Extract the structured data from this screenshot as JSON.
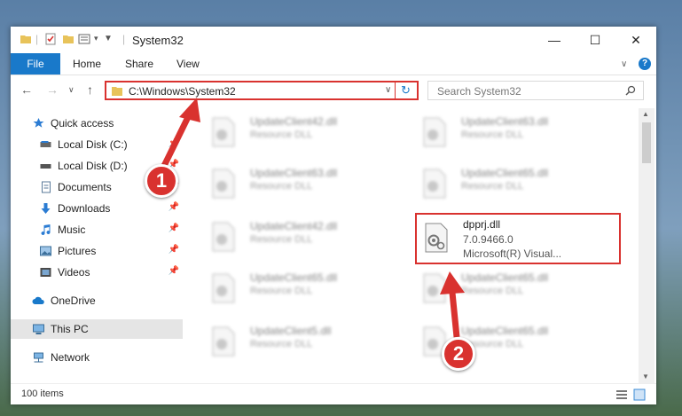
{
  "window": {
    "title": "System32",
    "minimize_glyph": "—",
    "maximize_glyph": "☐",
    "close_glyph": "✕"
  },
  "ribbon": {
    "file": "File",
    "home": "Home",
    "share": "Share",
    "view": "View",
    "collapse_glyph": "∨",
    "help_glyph": "?"
  },
  "address": {
    "path": "C:\\Windows\\System32",
    "dropdown_glyph": "∨",
    "refresh_glyph": "↻"
  },
  "search": {
    "placeholder": "Search System32"
  },
  "nav": {
    "back_glyph": "←",
    "forward_glyph": "→",
    "recent_glyph": "∨",
    "up_glyph": "↑"
  },
  "sidebar": {
    "items": [
      {
        "label": "Quick access",
        "icon": "star-icon"
      },
      {
        "label": "Local Disk (C:)",
        "icon": "drive-icon"
      },
      {
        "label": "Local Disk (D:)",
        "icon": "drive-icon"
      },
      {
        "label": "Documents",
        "icon": "documents-icon"
      },
      {
        "label": "Downloads",
        "icon": "downloads-icon"
      },
      {
        "label": "Music",
        "icon": "music-icon"
      },
      {
        "label": "Pictures",
        "icon": "pictures-icon"
      },
      {
        "label": "Videos",
        "icon": "videos-icon"
      },
      {
        "label": "OneDrive",
        "icon": "cloud-icon"
      },
      {
        "label": "This PC",
        "icon": "computer-icon"
      },
      {
        "label": "Network",
        "icon": "network-icon"
      }
    ]
  },
  "files": [
    {
      "name": "UpdateClient42.dll",
      "type": "Resource DLL"
    },
    {
      "name": "UpdateClient63.dll",
      "type": "Resource DLL"
    },
    {
      "name": "UpdateClient63.dll",
      "type": "Resource DLL"
    },
    {
      "name": "UpdateClient65.dll",
      "type": "Resource DLL"
    },
    {
      "name": "UpdateClient42.dll",
      "type": "Resource DLL"
    },
    {
      "name": "UpdateClient65.dll",
      "type": "Resource DLL"
    },
    {
      "name": "UpdateClient65.dll",
      "type": "Resource DLL"
    },
    {
      "name": "UpdateClient5.dll",
      "type": "Resource DLL"
    },
    {
      "name": "UpdateClient65.dll",
      "type": "Resource DLL"
    }
  ],
  "target_file": {
    "name": "dpprj.dll",
    "version": "7.0.9466.0",
    "description": "Microsoft(R) Visual..."
  },
  "callouts": {
    "one": "1",
    "two": "2",
    "color": "#d9322f"
  },
  "status": {
    "item_count": "100 items"
  },
  "colors": {
    "accent": "#1979ca",
    "highlight": "#d9322f"
  }
}
